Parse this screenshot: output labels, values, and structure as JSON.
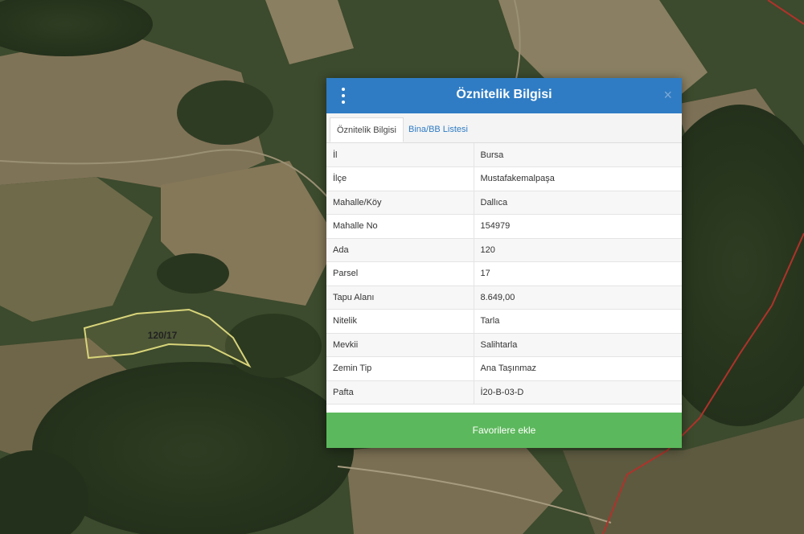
{
  "map": {
    "parcel_label": "120/17",
    "colors": {
      "parcel_outline": "#d8d47a",
      "boundary_line": "#b0322a"
    }
  },
  "modal": {
    "title": "Öznitelik Bilgisi",
    "menu_icon": "vertical-dots-icon",
    "close_icon": "×",
    "tabs": [
      {
        "label": "Öznitelik Bilgisi",
        "active": true
      },
      {
        "label": "Bina/BB Listesi",
        "active": false
      }
    ],
    "rows": [
      {
        "key": "İl",
        "value": "Bursa"
      },
      {
        "key": "İlçe",
        "value": "Mustafakemalpaşa"
      },
      {
        "key": "Mahalle/Köy",
        "value": "Dallıca"
      },
      {
        "key": "Mahalle No",
        "value": "154979"
      },
      {
        "key": "Ada",
        "value": "120"
      },
      {
        "key": "Parsel",
        "value": "17"
      },
      {
        "key": "Tapu Alanı",
        "value": "8.649,00"
      },
      {
        "key": "Nitelik",
        "value": "Tarla"
      },
      {
        "key": "Mevkii",
        "value": "Salihtarla"
      },
      {
        "key": "Zemin Tip",
        "value": "Ana Taşınmaz"
      },
      {
        "key": "Pafta",
        "value": "İ20-B-03-D"
      }
    ],
    "favorite_button": "Favorilere ekle",
    "colors": {
      "header": "#2f7cc4",
      "button": "#5cb85c"
    }
  }
}
